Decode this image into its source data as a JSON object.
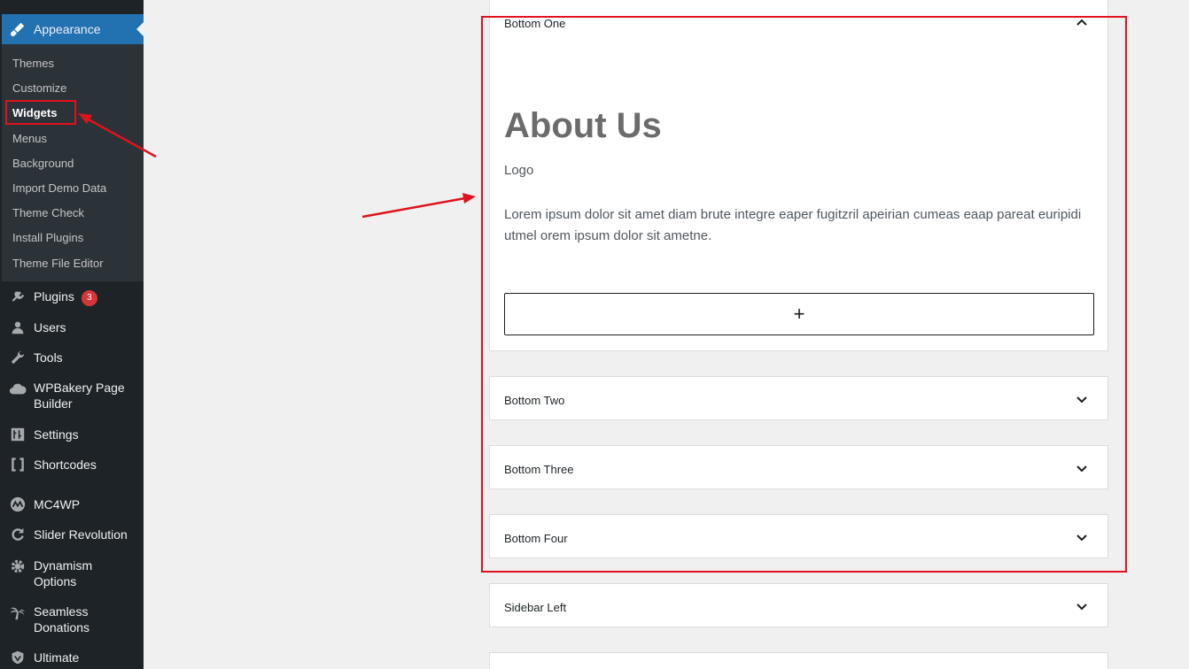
{
  "sidebar": {
    "appearance_label": "Appearance",
    "submenu": [
      "Themes",
      "Customize",
      "Widgets",
      "Menus",
      "Background",
      "Import Demo Data",
      "Theme Check",
      "Install Plugins",
      "Theme File Editor"
    ],
    "current_submenu": "Widgets",
    "menu": [
      {
        "label": "Plugins",
        "icon": "plugin-icon",
        "badge": "3"
      },
      {
        "label": "Users",
        "icon": "user-icon"
      },
      {
        "label": "Tools",
        "icon": "wrench-icon"
      },
      {
        "label": "WPBakery Page Builder",
        "icon": "cloud-icon"
      },
      {
        "label": "Settings",
        "icon": "settings-icon"
      },
      {
        "label": "Shortcodes",
        "icon": "brackets-icon"
      },
      {
        "label": "MC4WP",
        "icon": "mc4wp-icon"
      },
      {
        "label": "Slider Revolution",
        "icon": "refresh-icon"
      },
      {
        "label": "Dynamism Options",
        "icon": "gear-icon"
      },
      {
        "label": "Seamless Donations",
        "icon": "palm-icon"
      },
      {
        "label": "Ultimate",
        "icon": "shield-icon"
      }
    ]
  },
  "widget_areas": [
    {
      "title": "Bottom One",
      "expanded": true
    },
    {
      "title": "Bottom Two",
      "expanded": false
    },
    {
      "title": "Bottom Three",
      "expanded": false
    },
    {
      "title": "Bottom Four",
      "expanded": false
    },
    {
      "title": "Sidebar Left",
      "expanded": false
    }
  ],
  "bottom_one_widget": {
    "heading": "About Us",
    "logo_text": "Logo",
    "paragraph": "Lorem ipsum dolor sit amet diam brute integre eaper fugitzril apeirian cumeas eaap pareat euripidi utmel orem ipsum dolor sit ametne.",
    "add_block_symbol": "+"
  },
  "colors": {
    "admin_bar": "#1d2327",
    "submenu_bg": "#2c3338",
    "accent": "#2271b1",
    "annotation": "#e0121c",
    "badge": "#d63638"
  }
}
